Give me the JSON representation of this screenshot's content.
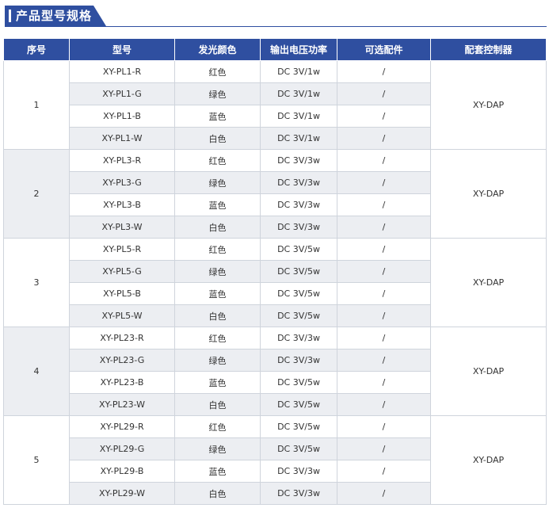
{
  "section_title": "产品型号规格",
  "headers": [
    "序号",
    "型号",
    "发光颜色",
    "输出电压功率",
    "可选配件",
    "配套控制器"
  ],
  "groups": [
    {
      "index": "1",
      "controller": "XY-DAP",
      "shade": false,
      "rows": [
        {
          "model": "XY-PL1-R",
          "color": "红色",
          "power": "DC 3V/1w",
          "accessory": "/"
        },
        {
          "model": "XY-PL1-G",
          "color": "绿色",
          "power": "DC 3V/1w",
          "accessory": "/"
        },
        {
          "model": "XY-PL1-B",
          "color": "蓝色",
          "power": "DC 3V/1w",
          "accessory": "/"
        },
        {
          "model": "XY-PL1-W",
          "color": "白色",
          "power": "DC 3V/1w",
          "accessory": "/"
        }
      ]
    },
    {
      "index": "2",
      "controller": "XY-DAP",
      "shade": true,
      "rows": [
        {
          "model": "XY-PL3-R",
          "color": "红色",
          "power": "DC 3V/3w",
          "accessory": "/"
        },
        {
          "model": "XY-PL3-G",
          "color": "绿色",
          "power": "DC 3V/3w",
          "accessory": "/"
        },
        {
          "model": "XY-PL3-B",
          "color": "蓝色",
          "power": "DC 3V/3w",
          "accessory": "/"
        },
        {
          "model": "XY-PL3-W",
          "color": "白色",
          "power": "DC 3V/3w",
          "accessory": "/"
        }
      ]
    },
    {
      "index": "3",
      "controller": "XY-DAP",
      "shade": false,
      "rows": [
        {
          "model": "XY-PL5-R",
          "color": "红色",
          "power": "DC 3V/5w",
          "accessory": "/"
        },
        {
          "model": "XY-PL5-G",
          "color": "绿色",
          "power": "DC 3V/5w",
          "accessory": "/"
        },
        {
          "model": "XY-PL5-B",
          "color": "蓝色",
          "power": "DC 3V/5w",
          "accessory": "/"
        },
        {
          "model": "XY-PL5-W",
          "color": "白色",
          "power": "DC 3V/5w",
          "accessory": "/"
        }
      ]
    },
    {
      "index": "4",
      "controller": "XY-DAP",
      "shade": true,
      "rows": [
        {
          "model": "XY-PL23-R",
          "color": "红色",
          "power": "DC 3V/3w",
          "accessory": "/"
        },
        {
          "model": "XY-PL23-G",
          "color": "绿色",
          "power": "DC 3V/3w",
          "accessory": "/"
        },
        {
          "model": "XY-PL23-B",
          "color": "蓝色",
          "power": "DC 3V/5w",
          "accessory": "/"
        },
        {
          "model": "XY-PL23-W",
          "color": "白色",
          "power": "DC 3V/5w",
          "accessory": "/"
        }
      ]
    },
    {
      "index": "5",
      "controller": "XY-DAP",
      "shade": false,
      "rows": [
        {
          "model": "XY-PL29-R",
          "color": "红色",
          "power": "DC 3V/5w",
          "accessory": "/"
        },
        {
          "model": "XY-PL29-G",
          "color": "绿色",
          "power": "DC 3V/5w",
          "accessory": "/"
        },
        {
          "model": "XY-PL29-B",
          "color": "蓝色",
          "power": "DC 3V/3w",
          "accessory": "/"
        },
        {
          "model": "XY-PL29-W",
          "color": "白色",
          "power": "DC 3V/3w",
          "accessory": "/"
        }
      ]
    }
  ],
  "colors": {
    "header_bg": "#2f4fa0",
    "alt_row_bg": "#eceef2",
    "border": "#cfd4dc"
  }
}
